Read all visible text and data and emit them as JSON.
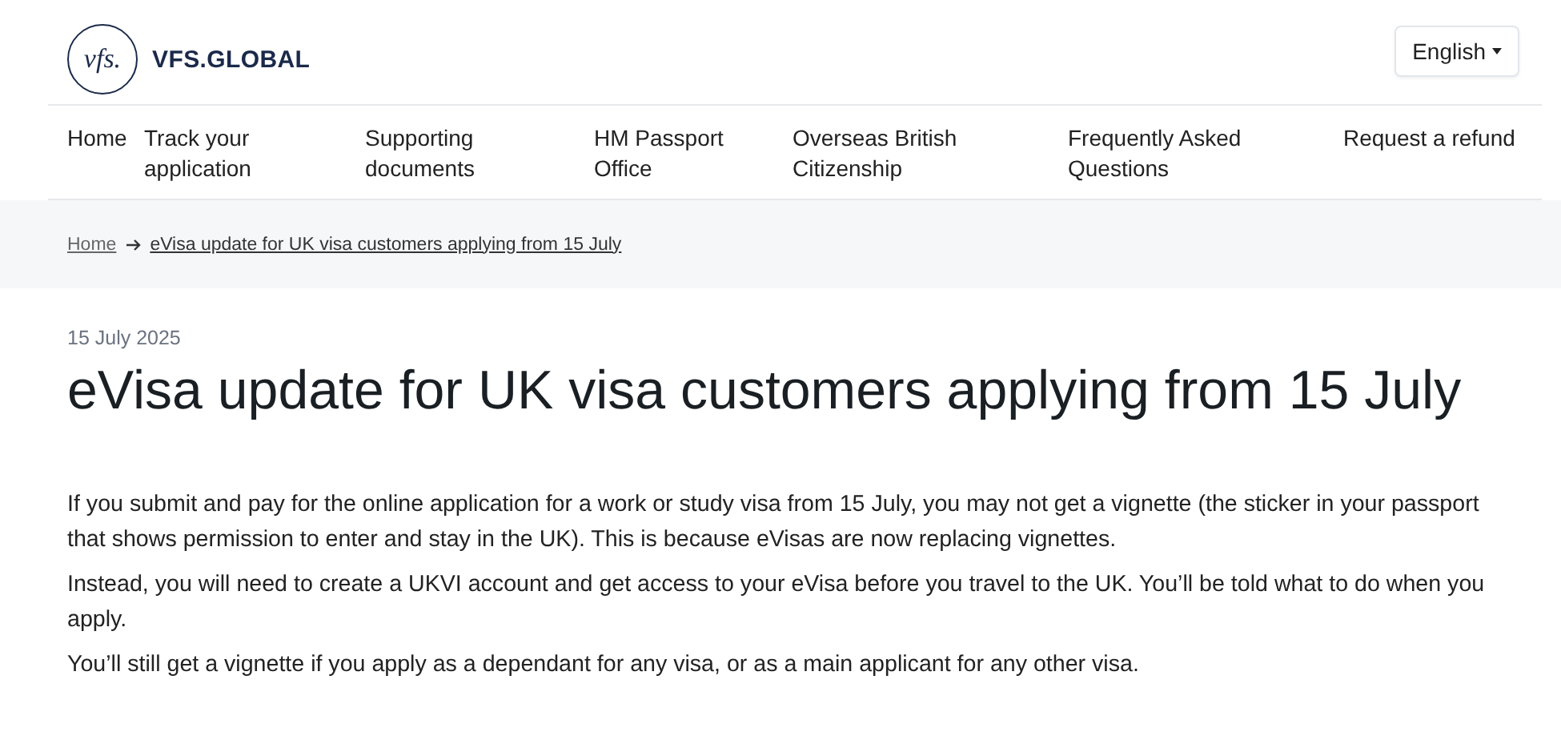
{
  "header": {
    "logo_mark": "vfs.",
    "brand": "VFS.GLOBAL",
    "language_button": "English"
  },
  "nav": [
    {
      "label": "Home"
    },
    {
      "label": "Track your application"
    },
    {
      "label": "Supporting documents"
    },
    {
      "label": "HM Passport Office"
    },
    {
      "label": "Overseas British Citizenship"
    },
    {
      "label": "Frequently Asked Questions"
    },
    {
      "label": "Request a refund"
    }
  ],
  "breadcrumb": [
    "Home",
    "eVisa update for UK visa customers applying from 15 July"
  ],
  "article": {
    "date": "15 July 2025",
    "title": "eVisa update for UK visa customers applying from 15 July",
    "paragraphs": [
      "If you submit and pay for the online application for a work or study visa from 15 July, you may not get a vignette (the sticker in your passport that shows permission to enter and stay in the UK). This is because eVisas are now replacing vignettes.",
      "Instead, you will need to create a UKVI account and get access to your eVisa before you travel to the UK. You’ll be told what to do when you apply.",
      "You’ll still get a vignette if you apply as a dependant for any visa, or as a main applicant for any other visa."
    ]
  }
}
